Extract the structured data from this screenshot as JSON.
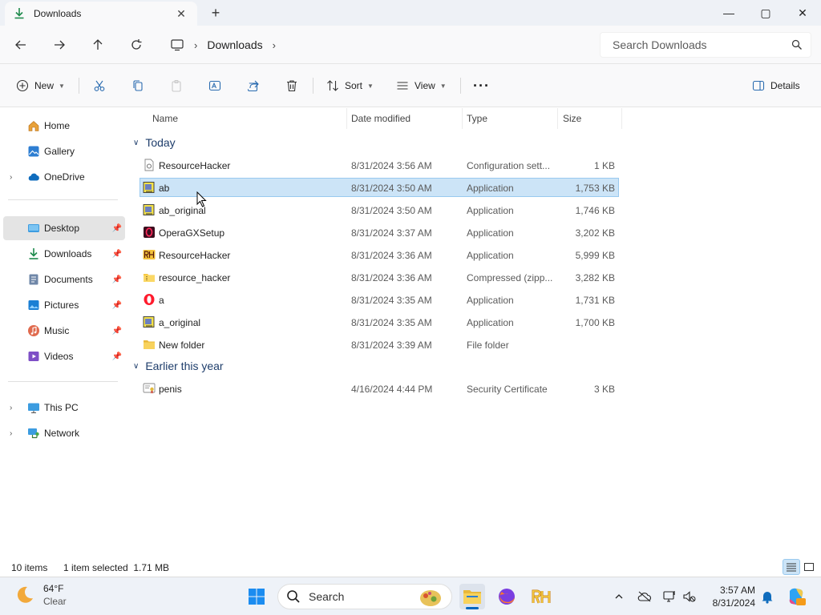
{
  "window": {
    "tab_title": "Downloads",
    "controls": {
      "minimize": "—",
      "maximize": "▢",
      "close": "✕"
    }
  },
  "address": {
    "crumbs": [
      "Downloads"
    ],
    "search_placeholder": "Search Downloads"
  },
  "toolbar": {
    "new_label": "New",
    "sort_label": "Sort",
    "view_label": "View",
    "details_label": "Details"
  },
  "sidebar": {
    "home": "Home",
    "gallery": "Gallery",
    "onedrive": "OneDrive",
    "pinned": [
      {
        "label": "Desktop"
      },
      {
        "label": "Downloads"
      },
      {
        "label": "Documents"
      },
      {
        "label": "Pictures"
      },
      {
        "label": "Music"
      },
      {
        "label": "Videos"
      }
    ],
    "this_pc": "This PC",
    "network": "Network"
  },
  "columns": {
    "name": "Name",
    "date": "Date modified",
    "type": "Type",
    "size": "Size"
  },
  "groups": {
    "today": {
      "label": "Today",
      "files": [
        {
          "name": "ResourceHacker",
          "date": "8/31/2024 3:56 AM",
          "type": "Configuration sett...",
          "size": "1 KB",
          "icon": "config-file-icon"
        },
        {
          "name": "ab",
          "date": "8/31/2024 3:50 AM",
          "type": "Application",
          "size": "1,753 KB",
          "icon": "app-icon"
        },
        {
          "name": "ab_original",
          "date": "8/31/2024 3:50 AM",
          "type": "Application",
          "size": "1,746 KB",
          "icon": "app-icon"
        },
        {
          "name": "OperaGXSetup",
          "date": "8/31/2024 3:37 AM",
          "type": "Application",
          "size": "3,202 KB",
          "icon": "opera-gx-icon"
        },
        {
          "name": "ResourceHacker",
          "date": "8/31/2024 3:36 AM",
          "type": "Application",
          "size": "5,999 KB",
          "icon": "resource-hacker-icon"
        },
        {
          "name": "resource_hacker",
          "date": "8/31/2024 3:36 AM",
          "type": "Compressed (zipp...",
          "size": "3,282 KB",
          "icon": "zip-folder-icon"
        },
        {
          "name": "a",
          "date": "8/31/2024 3:35 AM",
          "type": "Application",
          "size": "1,731 KB",
          "icon": "opera-icon"
        },
        {
          "name": "a_original",
          "date": "8/31/2024 3:35 AM",
          "type": "Application",
          "size": "1,700 KB",
          "icon": "app-icon"
        },
        {
          "name": "New folder",
          "date": "8/31/2024 3:39 AM",
          "type": "File folder",
          "size": "",
          "icon": "folder-icon"
        }
      ]
    },
    "earlier": {
      "label": "Earlier this year",
      "files": [
        {
          "name": "penis",
          "date": "4/16/2024 4:44 PM",
          "type": "Security Certificate",
          "size": "3 KB",
          "icon": "certificate-icon"
        }
      ]
    }
  },
  "status": {
    "count": "10 items",
    "selection": "1 item selected  1.71 MB"
  },
  "taskbar": {
    "temperature": "64°F",
    "condition": "Clear",
    "search_label": "Search",
    "time": "3:57 AM",
    "date": "8/31/2024"
  },
  "colors": {
    "accent": "#0067c0",
    "selection_bg": "#cce4f7",
    "selection_border": "#99c9ef",
    "group_header": "#1e3d6b"
  }
}
